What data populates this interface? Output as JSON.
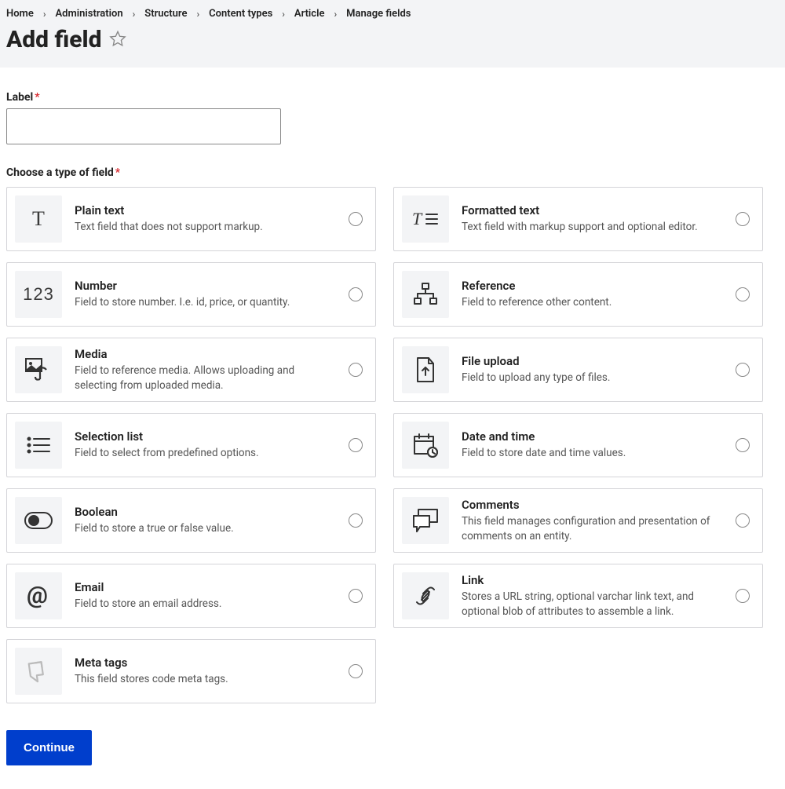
{
  "breadcrumb": [
    "Home",
    "Administration",
    "Structure",
    "Content types",
    "Article",
    "Manage fields"
  ],
  "page_title": "Add field",
  "label_field": {
    "label": "Label",
    "value": ""
  },
  "choose_label": "Choose a type of field",
  "fields": [
    {
      "key": "plain-text",
      "title": "Plain text",
      "desc": "Text field that does not support markup."
    },
    {
      "key": "formatted-text",
      "title": "Formatted text",
      "desc": "Text field with markup support and optional editor."
    },
    {
      "key": "number",
      "title": "Number",
      "desc": "Field to store number. I.e. id, price, or quantity."
    },
    {
      "key": "reference",
      "title": "Reference",
      "desc": "Field to reference other content."
    },
    {
      "key": "media",
      "title": "Media",
      "desc": "Field to reference media. Allows uploading and selecting from uploaded media."
    },
    {
      "key": "file-upload",
      "title": "File upload",
      "desc": "Field to upload any type of files."
    },
    {
      "key": "selection-list",
      "title": "Selection list",
      "desc": "Field to select from predefined options."
    },
    {
      "key": "date-time",
      "title": "Date and time",
      "desc": "Field to store date and time values."
    },
    {
      "key": "boolean",
      "title": "Boolean",
      "desc": "Field to store a true or false value."
    },
    {
      "key": "comments",
      "title": "Comments",
      "desc": "This field manages configuration and presentation of comments on an entity."
    },
    {
      "key": "email",
      "title": "Email",
      "desc": "Field to store an email address."
    },
    {
      "key": "link",
      "title": "Link",
      "desc": "Stores a URL string, optional varchar link text, and optional blob of attributes to assemble a link."
    },
    {
      "key": "meta-tags",
      "title": "Meta tags",
      "desc": "This field stores code meta tags."
    }
  ],
  "submit_label": "Continue"
}
